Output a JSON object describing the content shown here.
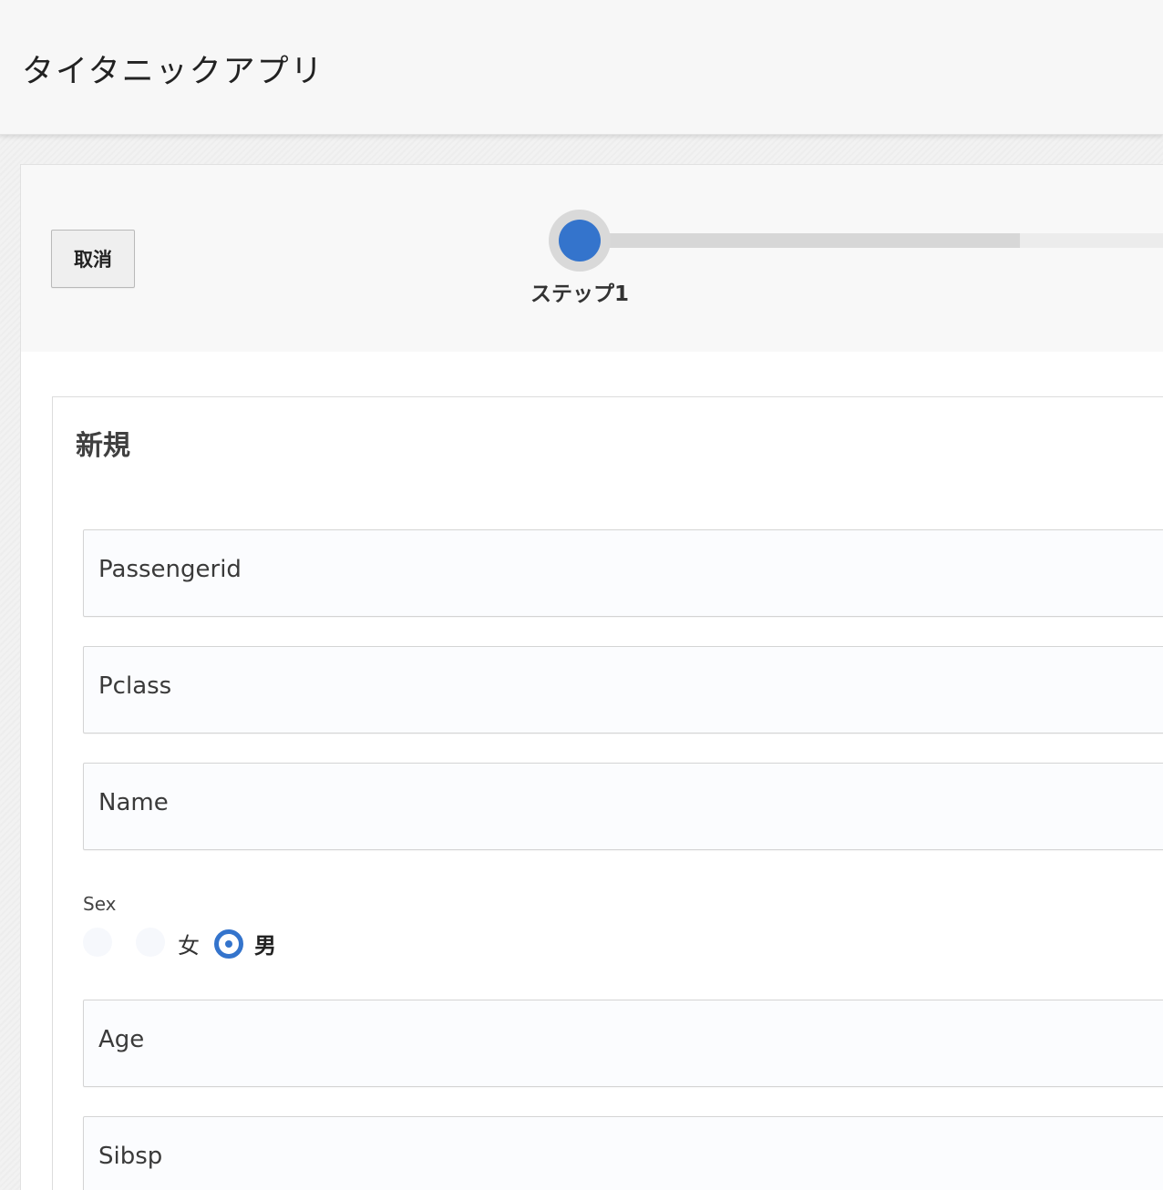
{
  "header": {
    "title": "タイタニックアプリ"
  },
  "wizard": {
    "cancel_label": "取消",
    "step_label": "ステップ1",
    "progress_fraction": 0.74,
    "accent_color": "#3474cc"
  },
  "form": {
    "title": "新規",
    "fields": {
      "passengerid": "Passengerid",
      "pclass": "Pclass",
      "name": "Name",
      "age": "Age",
      "sibsp": "Sibsp"
    },
    "sex": {
      "label": "Sex",
      "options": [
        "女",
        "男"
      ],
      "selected": "男"
    }
  }
}
